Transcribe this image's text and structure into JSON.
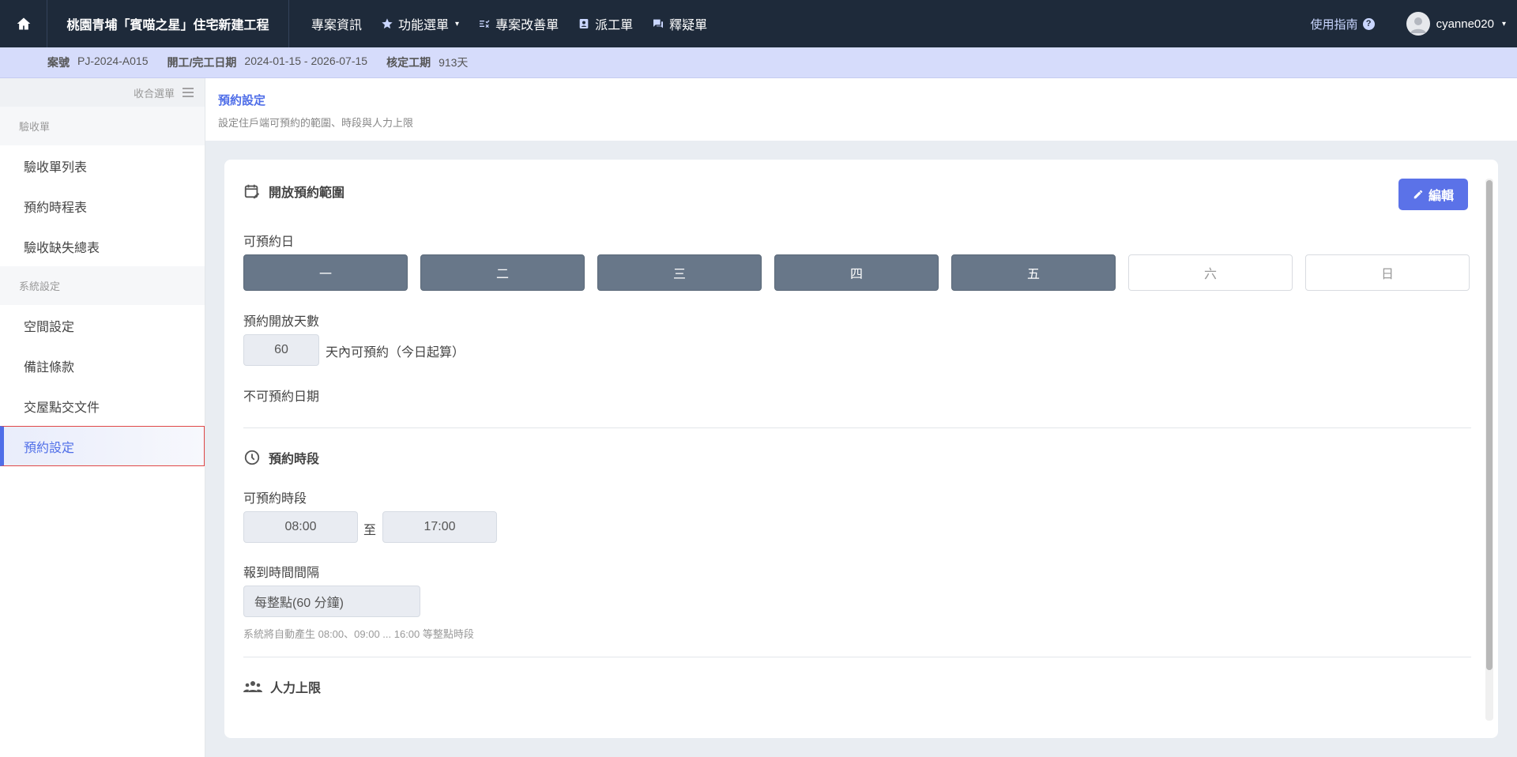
{
  "topnav": {
    "project_title": "桃園青埔「賓喵之星」住宅新建工程",
    "items": [
      {
        "label": "專案資訊"
      },
      {
        "label": "功能選單"
      },
      {
        "label": "專案改善單"
      },
      {
        "label": "派工單"
      },
      {
        "label": "釋疑單"
      }
    ],
    "guide": "使用指南",
    "username": "cyanne020"
  },
  "infobar": {
    "case_label": "案號",
    "case_value": "PJ-2024-A015",
    "date_label": "開工/完工日期",
    "date_value": "2024-01-15 - 2026-07-15",
    "period_label": "核定工期",
    "period_value": "913天"
  },
  "sidebar": {
    "collapse_label": "收合選單",
    "groups": [
      {
        "label": "驗收單",
        "items": [
          "驗收單列表",
          "預約時程表",
          "驗收缺失總表"
        ]
      },
      {
        "label": "系統設定",
        "items": [
          "空間設定",
          "備註條款",
          "交屋點交文件",
          "預約設定"
        ]
      }
    ]
  },
  "page": {
    "title": "預約設定",
    "subtitle": "設定住戶端可預約的範圍、時段與人力上限"
  },
  "card": {
    "edit_label": "編輯",
    "range": {
      "title": "開放預約範圍",
      "days_label": "可預約日",
      "days": [
        {
          "label": "一",
          "enabled": true
        },
        {
          "label": "二",
          "enabled": true
        },
        {
          "label": "三",
          "enabled": true
        },
        {
          "label": "四",
          "enabled": true
        },
        {
          "label": "五",
          "enabled": true
        },
        {
          "label": "六",
          "enabled": false
        },
        {
          "label": "日",
          "enabled": false
        }
      ],
      "open_days_label": "預約開放天數",
      "open_days_value": "60",
      "open_days_suffix": "天內可預約（今日起算）",
      "blocked_label": "不可預約日期"
    },
    "slots": {
      "title": "預約時段",
      "range_label": "可預約時段",
      "start": "08:00",
      "to": "至",
      "end": "17:00",
      "interval_label": "報到時間間隔",
      "interval_value": "每整點(60 分鐘)",
      "hint": "系統將自動產生 08:00、09:00 ... 16:00 等整點時段"
    },
    "capacity": {
      "title": "人力上限"
    }
  },
  "colors": {
    "nav_bg": "#1e2a3a",
    "accent": "#4f6ee8",
    "infobar_bg": "#d6dcfb",
    "day_on": "#687789"
  }
}
